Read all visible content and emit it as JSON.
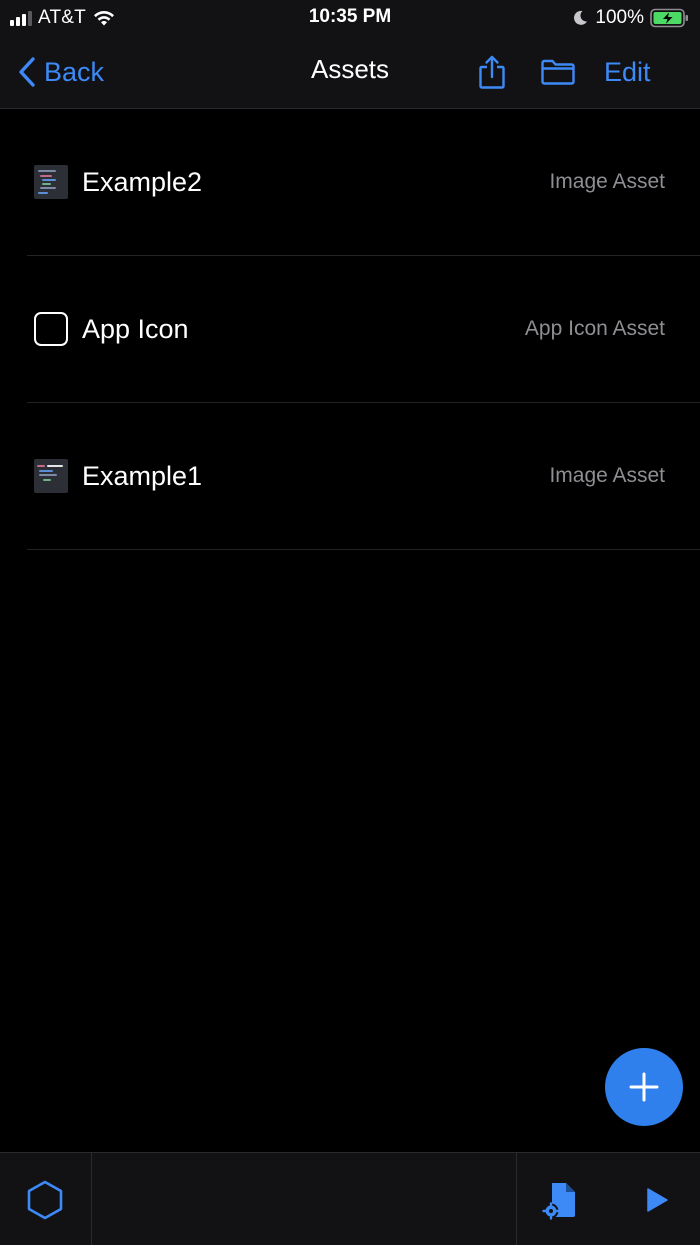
{
  "status_bar": {
    "carrier": "AT&T",
    "time": "10:35 PM",
    "battery": "100%"
  },
  "nav": {
    "back_label": "Back",
    "title": "Assets",
    "edit_label": "Edit"
  },
  "assets": [
    {
      "name": "Example2",
      "type": "Image Asset",
      "icon": "image-thumbnail"
    },
    {
      "name": "App Icon",
      "type": "App Icon Asset",
      "icon": "app-icon-outline"
    },
    {
      "name": "Example1",
      "type": "Image Asset",
      "icon": "image-thumbnail"
    }
  ],
  "colors": {
    "accent": "#2f80ed",
    "background": "#000000",
    "bar_background": "#121214",
    "secondary_text": "#8e8e93",
    "battery_fill": "#4cd964"
  },
  "icons": {
    "back": "chevron-left-icon",
    "share": "share-icon",
    "folder": "folder-icon",
    "add": "plus-icon",
    "hexagon": "hexagon-icon",
    "settings_doc": "document-gear-icon",
    "run": "play-icon"
  }
}
